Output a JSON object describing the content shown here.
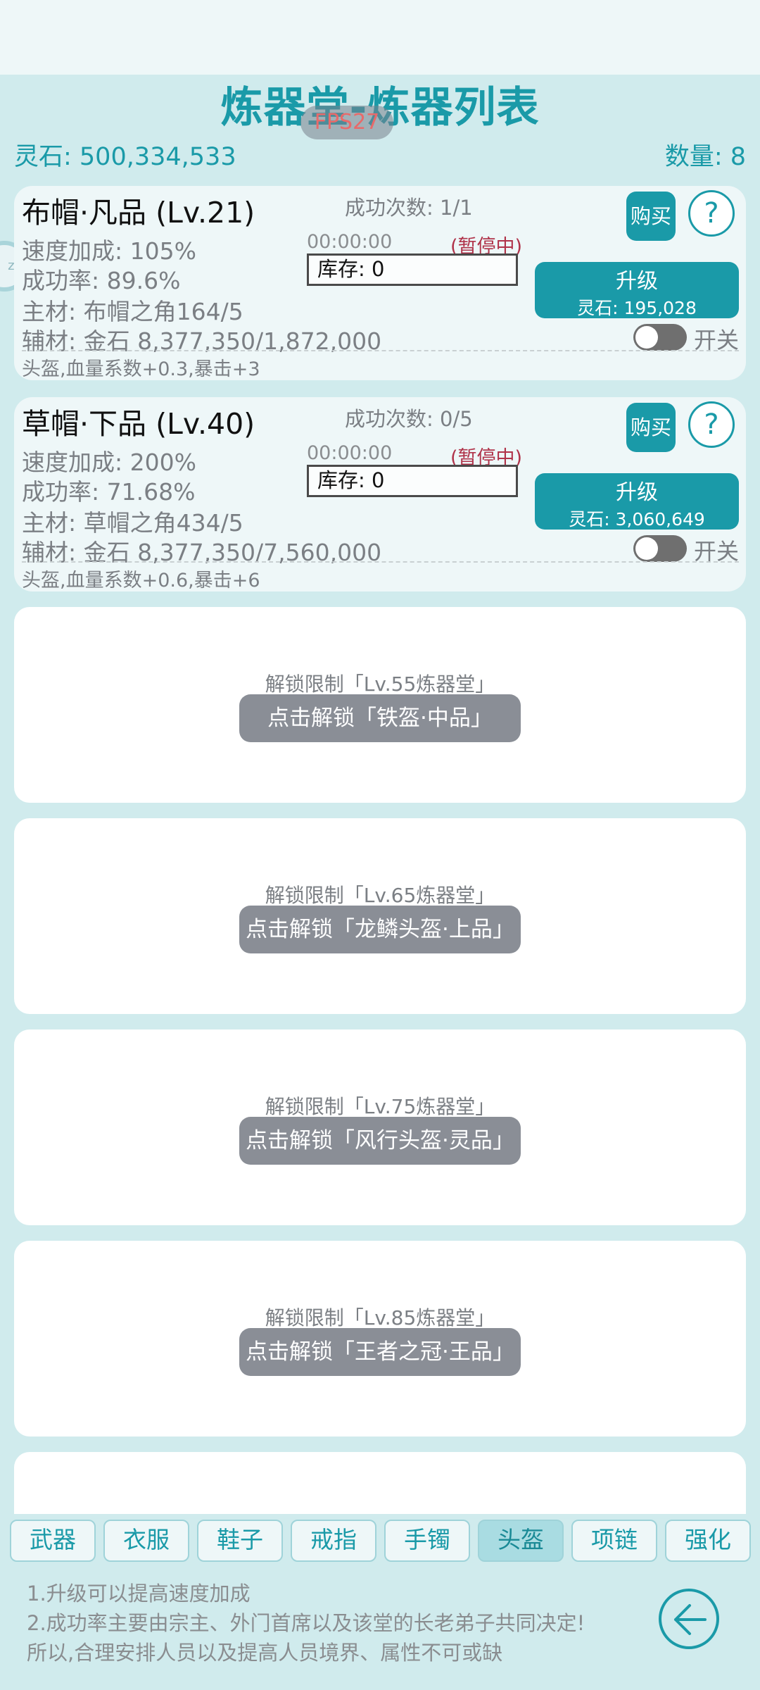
{
  "header": {
    "title": "炼器堂-炼器列表",
    "fps": "FPS27",
    "currency_text": "灵石: 500,334,533",
    "count_text": "数量: 8",
    "side_knob_text": "zz"
  },
  "items": [
    {
      "name": "布帽·凡品 (Lv.21)",
      "success": "成功次数: 1/1",
      "speed": "速度加成: 105%",
      "rate": "成功率: 89.6%",
      "main_material": "主材: 布帽之角164/5",
      "aux_material": "辅材: 金石 8,377,350/1,872,000",
      "timer": "00:00:00",
      "status": "(暂停中)",
      "stock": "库存: 0",
      "buy_label": "购买",
      "help": "?",
      "upgrade_label": "升级",
      "upgrade_cost": "灵石: 195,028",
      "toggle_label": "开关",
      "toggle_on": false,
      "effect": "头盔,血量系数+0.3,暴击+3"
    },
    {
      "name": "草帽·下品 (Lv.40)",
      "success": "成功次数: 0/5",
      "speed": "速度加成: 200%",
      "rate": "成功率: 71.68%",
      "main_material": "主材: 草帽之角434/5",
      "aux_material": "辅材: 金石 8,377,350/7,560,000",
      "timer": "00:00:00",
      "status": "(暂停中)",
      "stock": "库存: 0",
      "buy_label": "购买",
      "help": "?",
      "upgrade_label": "升级",
      "upgrade_cost": "灵石: 3,060,649",
      "toggle_label": "开关",
      "toggle_on": false,
      "effect": "头盔,血量系数+0.6,暴击+6"
    }
  ],
  "locked": [
    {
      "requirement": "解锁限制「Lv.55炼器堂」",
      "button": "点击解锁「铁盔·中品」"
    },
    {
      "requirement": "解锁限制「Lv.65炼器堂」",
      "button": "点击解锁「龙鳞头盔·上品」"
    },
    {
      "requirement": "解锁限制「Lv.75炼器堂」",
      "button": "点击解锁「风行头盔·灵品」"
    },
    {
      "requirement": "解锁限制「Lv.85炼器堂」",
      "button": "点击解锁「王者之冠·王品」"
    }
  ],
  "tabs": [
    "武器",
    "衣服",
    "鞋子",
    "戒指",
    "手镯",
    "头盔",
    "项链",
    "强化"
  ],
  "active_tab": "头盔",
  "tips": [
    "1.升级可以提高速度加成",
    "2.成功率主要由宗主、外门首席以及该堂的长老弟子共同决定!",
    "所以,合理安排人员以及提高人员境界、属性不可或缺"
  ],
  "colors": {
    "accent": "#1a9aa8",
    "background": "#d0ebed",
    "paused": "#b0334a",
    "locked_button": "#8a8e96"
  },
  "icons": {
    "back": "arrow-left-circle-icon",
    "help": "question-circle-icon"
  }
}
